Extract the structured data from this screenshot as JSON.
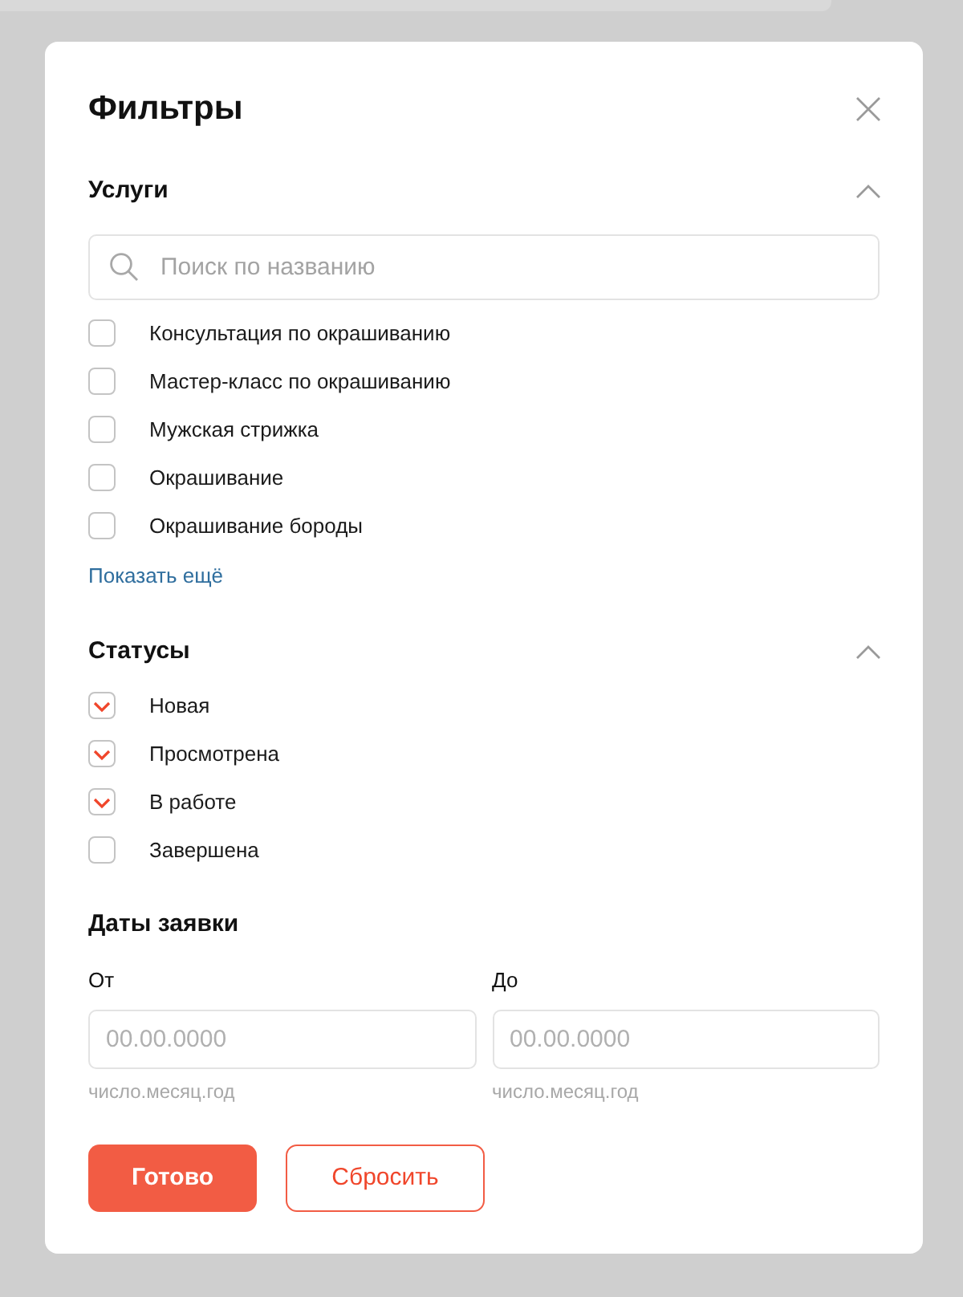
{
  "title": "Фильтры",
  "services": {
    "title": "Услуги",
    "expanded": true,
    "search": {
      "placeholder": "Поиск по названию"
    },
    "items": [
      {
        "label": "Консультация по окрашиванию",
        "checked": false
      },
      {
        "label": "Мастер-класс по окрашиванию",
        "checked": false
      },
      {
        "label": "Мужская стрижка",
        "checked": false
      },
      {
        "label": "Окрашивание",
        "checked": false
      },
      {
        "label": "Окрашивание бороды",
        "checked": false
      }
    ],
    "show_more": "Показать ещё"
  },
  "statuses": {
    "title": "Статусы",
    "expanded": true,
    "items": [
      {
        "label": "Новая",
        "checked": true
      },
      {
        "label": "Просмотрена",
        "checked": true
      },
      {
        "label": "В работе",
        "checked": true
      },
      {
        "label": "Завершена",
        "checked": false
      }
    ]
  },
  "dates": {
    "title": "Даты заявки",
    "fields": [
      {
        "label": "От",
        "placeholder": "00.00.0000",
        "hint": "число.месяц.год"
      },
      {
        "label": "До",
        "placeholder": "00.00.0000",
        "hint": "число.месяц.год"
      }
    ]
  },
  "buttons": [
    {
      "label": "Готово",
      "kind": "primary"
    },
    {
      "label": "Сбросить",
      "kind": "secondary"
    }
  ]
}
